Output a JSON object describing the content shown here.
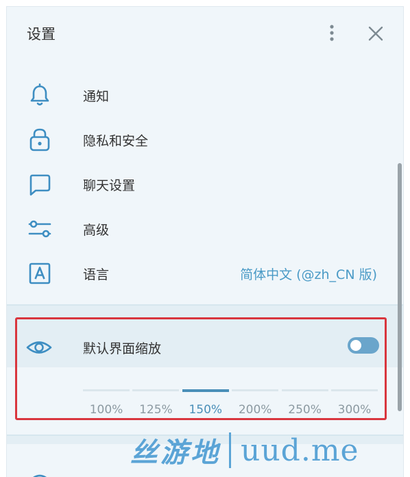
{
  "header": {
    "title": "设置"
  },
  "menu": [
    {
      "id": "notifications",
      "label": "通知",
      "icon": "bell-icon"
    },
    {
      "id": "privacy",
      "label": "隐私和安全",
      "icon": "lock-icon"
    },
    {
      "id": "chat",
      "label": "聊天设置",
      "icon": "chat-bubble-icon"
    },
    {
      "id": "advanced",
      "label": "高级",
      "icon": "sliders-icon"
    },
    {
      "id": "language",
      "label": "语言",
      "icon": "language-icon",
      "value": "简体中文 (@zh_CN 版)"
    }
  ],
  "scale": {
    "label": "默认界面缩放",
    "icon": "eye-icon",
    "toggle_on": false,
    "options": [
      "100%",
      "125%",
      "150%",
      "200%",
      "250%",
      "300%"
    ],
    "selected_index": 2
  },
  "watermark": {
    "cn": "丝游地",
    "en": "uud.me"
  },
  "colors": {
    "accent": "#4a8fb8",
    "highlight": "#d9363e",
    "panel_bg": "#f0f6fa"
  }
}
